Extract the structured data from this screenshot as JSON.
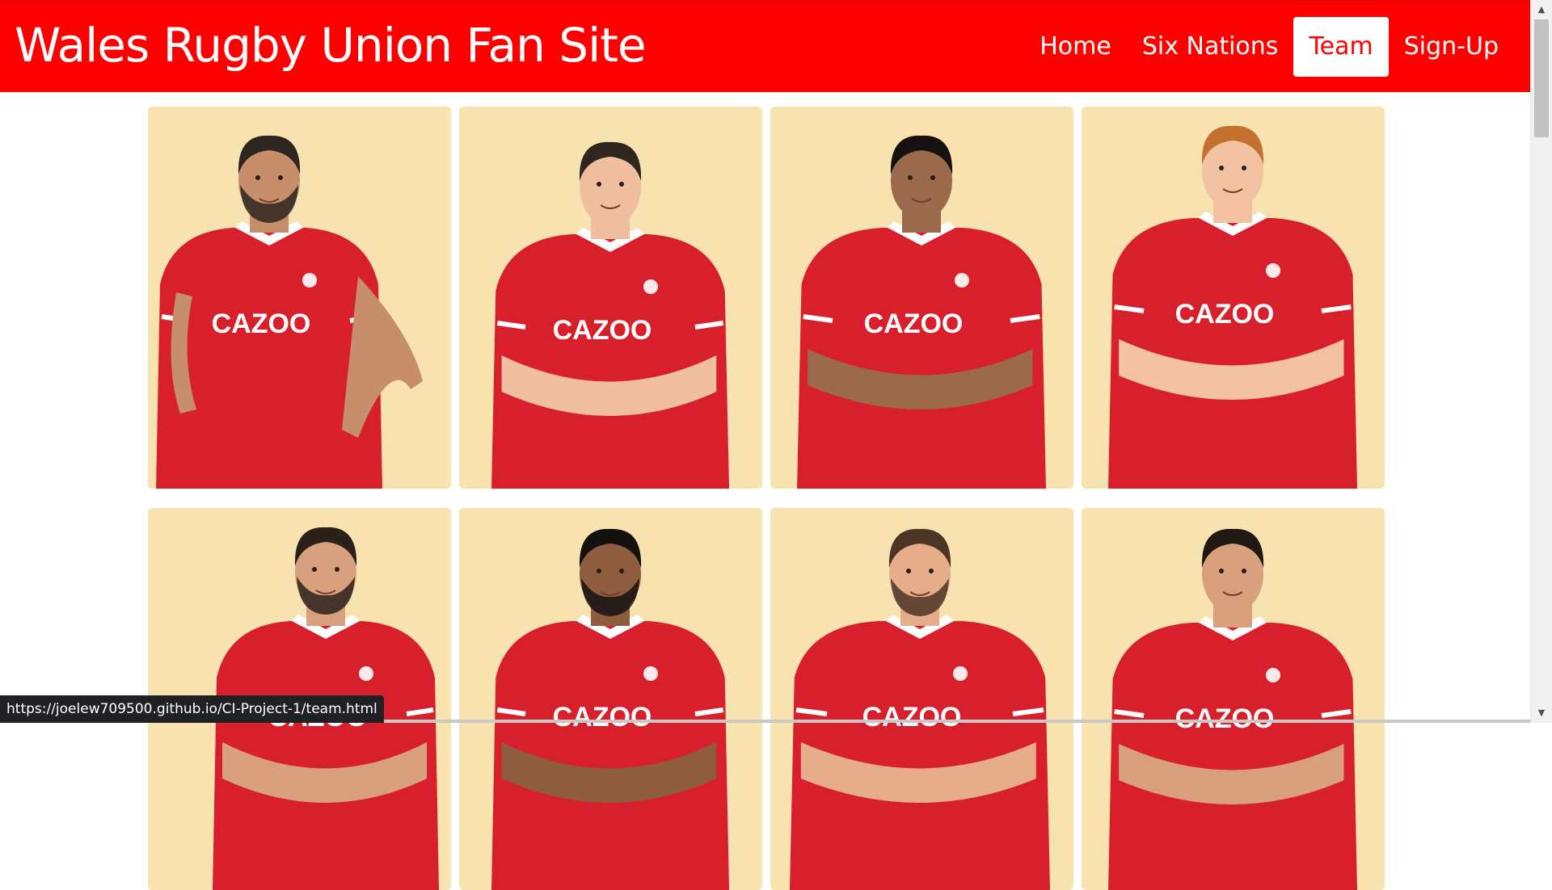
{
  "site": {
    "brand": "Wales Rugby Union Fan Site",
    "nav": [
      {
        "label": "Home",
        "active": false
      },
      {
        "label": "Six Nations",
        "active": false
      },
      {
        "label": "Team",
        "active": true
      },
      {
        "label": "Sign-Up",
        "active": false
      }
    ]
  },
  "players": [
    {
      "image": "player-photo",
      "skin": "#c68e6a",
      "hair": "#2e2420",
      "beard": true,
      "pose": "hands-on-hips"
    },
    {
      "image": "player-photo",
      "skin": "#f0bfa0",
      "hair": "#2f2620",
      "beard": false,
      "pose": "arms-crossed"
    },
    {
      "image": "player-photo",
      "skin": "#9b6a4c",
      "hair": "#171210",
      "beard": false,
      "pose": "arms-crossed"
    },
    {
      "image": "player-photo",
      "skin": "#f3c2a3",
      "hair": "#c4702e",
      "beard": false,
      "pose": "arms-crossed"
    },
    {
      "image": "player-photo",
      "skin": "#d9a07e",
      "hair": "#2a211b",
      "beard": true,
      "pose": "arms-crossed"
    },
    {
      "image": "player-photo",
      "skin": "#8e5d3f",
      "hair": "#151110",
      "beard": true,
      "pose": "arms-crossed"
    },
    {
      "image": "player-photo",
      "skin": "#e7ad8a",
      "hair": "#4b3526",
      "beard": true,
      "pose": "arms-crossed"
    },
    {
      "image": "player-photo",
      "skin": "#d9a07e",
      "hair": "#1f1813",
      "beard": false,
      "pose": "arms-crossed"
    }
  ],
  "jersey": {
    "sponsor": "CAZOO",
    "color": "#d7202b",
    "trim": "#ffffff"
  },
  "colors": {
    "nav_bg": "#ff0000",
    "card_bg": "#f8e3b0",
    "active_nav_text": "#ff0000"
  },
  "status": {
    "link_url": "https://joelew709500.github.io/CI-Project-1/team.html"
  }
}
